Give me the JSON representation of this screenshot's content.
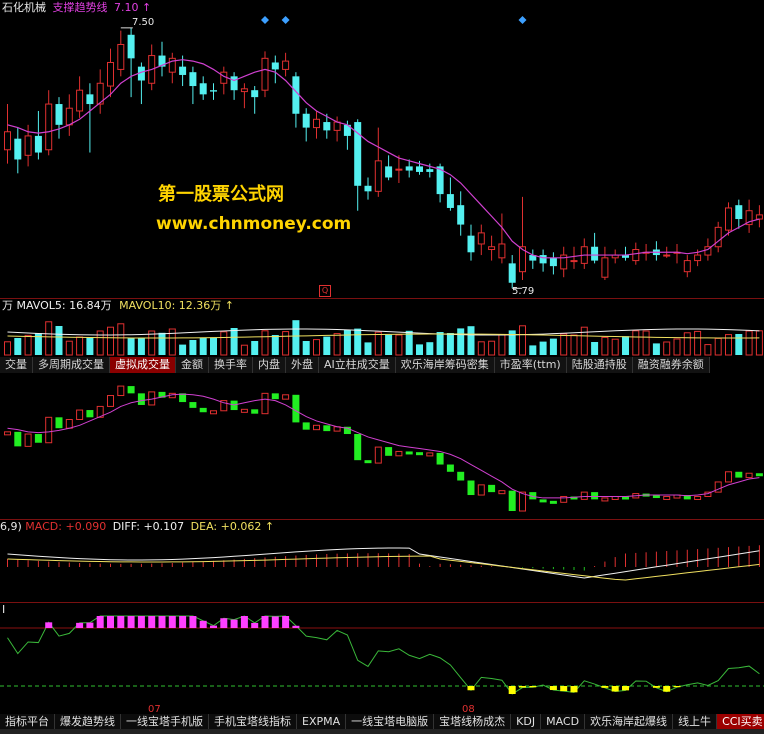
{
  "header": {
    "stock_name": "石化机械",
    "indicator_name": "支撑趋势线",
    "indicator_value": "7.10",
    "up_arrow": "↑"
  },
  "price_chart": {
    "high_label": "7.50",
    "low_label": "5.79",
    "watermark_cn": "第一股票公式网",
    "watermark_url": "www.chnmoney.com",
    "marker_letter": "Q",
    "colors": {
      "up": "#e03030",
      "down": "#54f0f0",
      "ma": "#d040d0",
      "diamond": "#3da0ff"
    },
    "candles": [
      {
        "o": 6.62,
        "c": 6.75,
        "h": 6.95,
        "l": 6.52
      },
      {
        "o": 6.7,
        "c": 6.55,
        "h": 6.78,
        "l": 6.45
      },
      {
        "o": 6.58,
        "c": 6.72,
        "h": 6.8,
        "l": 6.5
      },
      {
        "o": 6.72,
        "c": 6.6,
        "h": 6.9,
        "l": 6.55
      },
      {
        "o": 6.62,
        "c": 6.95,
        "h": 7.05,
        "l": 6.58
      },
      {
        "o": 6.95,
        "c": 6.8,
        "h": 7.0,
        "l": 6.7
      },
      {
        "o": 6.8,
        "c": 6.92,
        "h": 7.02,
        "l": 6.72
      },
      {
        "o": 6.9,
        "c": 7.05,
        "h": 7.15,
        "l": 6.85
      },
      {
        "o": 7.02,
        "c": 6.95,
        "h": 7.1,
        "l": 6.6
      },
      {
        "o": 6.95,
        "c": 7.1,
        "h": 7.2,
        "l": 6.88
      },
      {
        "o": 7.08,
        "c": 7.25,
        "h": 7.35,
        "l": 7.0
      },
      {
        "o": 7.2,
        "c": 7.38,
        "h": 7.48,
        "l": 7.15
      },
      {
        "o": 7.45,
        "c": 7.28,
        "h": 7.5,
        "l": 7.0
      },
      {
        "o": 7.22,
        "c": 7.12,
        "h": 7.25,
        "l": 6.95
      },
      {
        "o": 7.1,
        "c": 7.3,
        "h": 7.38,
        "l": 7.05
      },
      {
        "o": 7.3,
        "c": 7.22,
        "h": 7.4,
        "l": 7.15
      },
      {
        "o": 7.18,
        "c": 7.28,
        "h": 7.32,
        "l": 7.1
      },
      {
        "o": 7.22,
        "c": 7.16,
        "h": 7.3,
        "l": 7.08
      },
      {
        "o": 7.18,
        "c": 7.08,
        "h": 7.22,
        "l": 6.95
      },
      {
        "o": 7.1,
        "c": 7.02,
        "h": 7.15,
        "l": 6.98
      },
      {
        "o": 7.05,
        "c": 7.04,
        "h": 7.1,
        "l": 6.98
      },
      {
        "o": 7.1,
        "c": 7.18,
        "h": 7.22,
        "l": 7.02
      },
      {
        "o": 7.15,
        "c": 7.05,
        "h": 7.18,
        "l": 6.98
      },
      {
        "o": 7.04,
        "c": 7.06,
        "h": 7.1,
        "l": 6.92
      },
      {
        "o": 7.05,
        "c": 7.0,
        "h": 7.08,
        "l": 6.88
      },
      {
        "o": 7.05,
        "c": 7.28,
        "h": 7.33,
        "l": 7.0
      },
      {
        "o": 7.25,
        "c": 7.2,
        "h": 7.3,
        "l": 7.1
      },
      {
        "o": 7.2,
        "c": 7.26,
        "h": 7.32,
        "l": 7.15
      },
      {
        "o": 7.15,
        "c": 6.88,
        "h": 7.18,
        "l": 6.78
      },
      {
        "o": 6.88,
        "c": 6.78,
        "h": 6.92,
        "l": 6.68
      },
      {
        "o": 6.78,
        "c": 6.84,
        "h": 6.9,
        "l": 6.7
      },
      {
        "o": 6.82,
        "c": 6.76,
        "h": 6.88,
        "l": 6.7
      },
      {
        "o": 6.76,
        "c": 6.82,
        "h": 6.86,
        "l": 6.68
      },
      {
        "o": 6.8,
        "c": 6.72,
        "h": 6.83,
        "l": 6.62
      },
      {
        "o": 6.82,
        "c": 6.36,
        "h": 6.84,
        "l": 6.18
      },
      {
        "o": 6.36,
        "c": 6.32,
        "h": 6.42,
        "l": 6.26
      },
      {
        "o": 6.32,
        "c": 6.54,
        "h": 6.78,
        "l": 6.28
      },
      {
        "o": 6.5,
        "c": 6.42,
        "h": 6.58,
        "l": 6.4
      },
      {
        "o": 6.48,
        "c": 6.48,
        "h": 6.58,
        "l": 6.38
      },
      {
        "o": 6.5,
        "c": 6.47,
        "h": 6.55,
        "l": 6.42
      },
      {
        "o": 6.5,
        "c": 6.46,
        "h": 6.54,
        "l": 6.44
      },
      {
        "o": 6.48,
        "c": 6.46,
        "h": 6.52,
        "l": 6.42
      },
      {
        "o": 6.5,
        "c": 6.3,
        "h": 6.52,
        "l": 6.24
      },
      {
        "o": 6.3,
        "c": 6.2,
        "h": 6.42,
        "l": 6.18
      },
      {
        "o": 6.22,
        "c": 6.08,
        "h": 6.32,
        "l": 6.0
      },
      {
        "o": 6.0,
        "c": 5.88,
        "h": 6.08,
        "l": 5.82
      },
      {
        "o": 5.94,
        "c": 6.02,
        "h": 6.08,
        "l": 5.86
      },
      {
        "o": 5.9,
        "c": 5.92,
        "h": 6.0,
        "l": 5.82
      },
      {
        "o": 5.84,
        "c": 5.94,
        "h": 6.16,
        "l": 5.8
      },
      {
        "o": 5.8,
        "c": 5.66,
        "h": 5.86,
        "l": 5.62
      },
      {
        "o": 5.74,
        "c": 5.92,
        "h": 6.28,
        "l": 5.68
      },
      {
        "o": 5.86,
        "c": 5.82,
        "h": 5.9,
        "l": 5.76
      },
      {
        "o": 5.86,
        "c": 5.8,
        "h": 5.9,
        "l": 5.74
      },
      {
        "o": 5.84,
        "c": 5.78,
        "h": 5.88,
        "l": 5.72
      },
      {
        "o": 5.76,
        "c": 5.86,
        "h": 5.92,
        "l": 5.7
      },
      {
        "o": 5.82,
        "c": 5.82,
        "h": 5.92,
        "l": 5.76
      },
      {
        "o": 5.8,
        "c": 5.92,
        "h": 5.98,
        "l": 5.76
      },
      {
        "o": 5.92,
        "c": 5.82,
        "h": 6.02,
        "l": 5.8
      },
      {
        "o": 5.7,
        "c": 5.84,
        "h": 5.92,
        "l": 5.68
      },
      {
        "o": 5.84,
        "c": 5.86,
        "h": 5.9,
        "l": 5.8
      },
      {
        "o": 5.86,
        "c": 5.84,
        "h": 5.92,
        "l": 5.82
      },
      {
        "o": 5.82,
        "c": 5.9,
        "h": 5.95,
        "l": 5.79
      },
      {
        "o": 5.88,
        "c": 5.88,
        "h": 5.94,
        "l": 5.82
      },
      {
        "o": 5.9,
        "c": 5.86,
        "h": 5.96,
        "l": 5.82
      },
      {
        "o": 5.86,
        "c": 5.86,
        "h": 5.92,
        "l": 5.84
      },
      {
        "o": 5.88,
        "c": 5.88,
        "h": 5.94,
        "l": 5.8
      },
      {
        "o": 5.74,
        "c": 5.82,
        "h": 5.86,
        "l": 5.7
      },
      {
        "o": 5.82,
        "c": 5.86,
        "h": 5.9,
        "l": 5.78
      },
      {
        "o": 5.86,
        "c": 5.92,
        "h": 5.98,
        "l": 5.82
      },
      {
        "o": 5.92,
        "c": 6.06,
        "h": 6.1,
        "l": 5.88
      },
      {
        "o": 6.04,
        "c": 6.2,
        "h": 6.24,
        "l": 6.0
      },
      {
        "o": 6.22,
        "c": 6.12,
        "h": 6.26,
        "l": 6.05
      },
      {
        "o": 6.08,
        "c": 6.18,
        "h": 6.26,
        "l": 6.02
      },
      {
        "o": 6.12,
        "c": 6.15,
        "h": 6.22,
        "l": 6.06
      }
    ],
    "ma": [
      6.8,
      6.78,
      6.75,
      6.74,
      6.75,
      6.77,
      6.8,
      6.84,
      6.9,
      6.96,
      7.02,
      7.1,
      7.15,
      7.18,
      7.2,
      7.23,
      7.26,
      7.27,
      7.26,
      7.24,
      7.2,
      7.15,
      7.12,
      7.15,
      7.18,
      7.2,
      7.18,
      7.12,
      7.04,
      6.96,
      6.9,
      6.86,
      6.82,
      6.8,
      6.74,
      6.68,
      6.64,
      6.6,
      6.56,
      6.54,
      6.52,
      6.5,
      6.48,
      6.44,
      6.38,
      6.3,
      6.22,
      6.14,
      6.06,
      5.96,
      5.9,
      5.86,
      5.84,
      5.84,
      5.84,
      5.85,
      5.86,
      5.86,
      5.86,
      5.86,
      5.86,
      5.87,
      5.88,
      5.88,
      5.88,
      5.88,
      5.87,
      5.88,
      5.9,
      5.96,
      6.02,
      6.06,
      6.1,
      6.12
    ]
  },
  "volume_panel": {
    "header_label": "万",
    "mavol5_label": "MAVOL5:",
    "mavol5_value": "16.84万",
    "mavol10_label": "MAVOL10:",
    "mavol10_value": "12.36万",
    "up_arrow": "↑"
  },
  "indicator_tabs": [
    {
      "label": "交量",
      "active": false
    },
    {
      "label": "多周期成交量",
      "active": false
    },
    {
      "label": "虚拟成交量",
      "active": true
    },
    {
      "label": "金额",
      "active": false
    },
    {
      "label": "换手率",
      "active": false
    },
    {
      "label": "内盘",
      "active": false
    },
    {
      "label": "外盘",
      "active": false
    },
    {
      "label": "AI立柱成交量",
      "active": false
    },
    {
      "label": "欢乐海岸筹码密集",
      "active": false
    },
    {
      "label": "市盈率(ttm)",
      "active": false
    },
    {
      "label": "陆股通持股",
      "active": false
    },
    {
      "label": "融资融券余额",
      "active": false
    }
  ],
  "macd_panel": {
    "params": "6,9)",
    "macd_label": "MACD:",
    "macd_value": "+0.090",
    "diff_label": "DIFF:",
    "diff_value": "+0.107",
    "dea_label": "DEA:",
    "dea_value": "+0.062",
    "up_arrow": "↑",
    "colors": {
      "diff": "#f0f0f0",
      "dea": "#f0e060",
      "hist_pos": "#e03030",
      "hist_neg": "#20c020"
    }
  },
  "cci_panel": {
    "header_label": "I",
    "colors": {
      "line": "#3ab83a",
      "top_marks": "#ff40ff",
      "bottom_marks": "#ffff00",
      "dashed": "#30c030"
    }
  },
  "date_axis": {
    "labels": [
      "07",
      "08"
    ]
  },
  "bottom_tabs": [
    {
      "label": "指标平台",
      "active": false
    },
    {
      "label": "爆发趋势线",
      "active": false
    },
    {
      "label": "一线宝塔手机版",
      "active": false
    },
    {
      "label": "手机宝塔线指标",
      "active": false
    },
    {
      "label": "EXPMA",
      "active": false
    },
    {
      "label": "一线宝塔电脑版",
      "active": false
    },
    {
      "label": "宝塔线杨成杰",
      "active": false
    },
    {
      "label": "KDJ",
      "active": false
    },
    {
      "label": "MACD",
      "active": false
    },
    {
      "label": "欢乐海岸起爆线",
      "active": false
    },
    {
      "label": "线上牛",
      "active": false
    },
    {
      "label": "CCI买卖",
      "active": true
    }
  ]
}
